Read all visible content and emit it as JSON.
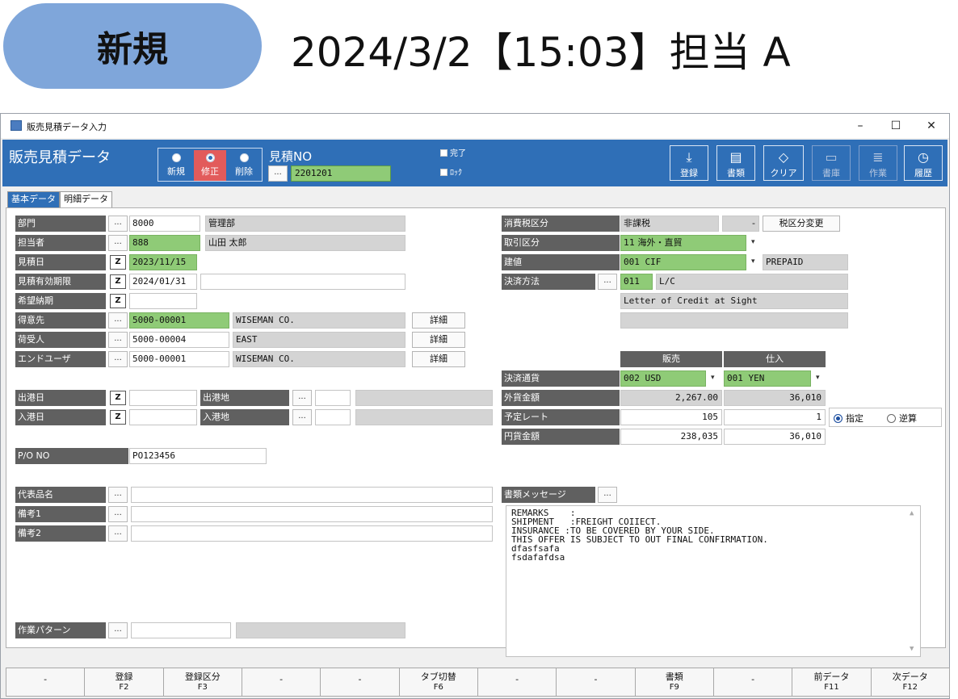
{
  "banner": {
    "mode": "新規",
    "title": "2024/3/2【15:03】担当 A"
  },
  "window": {
    "title": "販売見積データ入力",
    "controls": {
      "minimize": "–",
      "maximize": "☐",
      "close": "✕"
    }
  },
  "header": {
    "title": "販売見積データ",
    "modes": [
      {
        "label": "新規"
      },
      {
        "label": "修正"
      },
      {
        "label": "削除"
      }
    ],
    "mitsumori_label": "見積NO",
    "ellipsis": "...",
    "mitsumori_no": "2201201",
    "checks": {
      "done": "完了",
      "lock": "ﾛｯｸ"
    },
    "tools": [
      {
        "label": "登録",
        "icon": "⤓"
      },
      {
        "label": "書類",
        "icon": "▤"
      },
      {
        "label": "クリア",
        "icon": "◇"
      },
      {
        "label": "書庫",
        "icon": "▭"
      },
      {
        "label": "作業",
        "icon": "≣"
      },
      {
        "label": "履歴",
        "icon": "◷"
      }
    ]
  },
  "tabs": {
    "basic": "基本データ",
    "detail": "明細データ"
  },
  "left": {
    "dept": {
      "label": "部門",
      "code": "8000",
      "name": "管理部"
    },
    "staff": {
      "label": "担当者",
      "code": "888",
      "name": "山田 太郎"
    },
    "quote_date": {
      "label": "見積日",
      "value": "2023/11/15"
    },
    "valid_until": {
      "label": "見積有効期限",
      "value": "2024/01/31"
    },
    "desired_delivery": {
      "label": "希望納期"
    },
    "customer": {
      "label": "得意先",
      "code": "5000-00001",
      "name": "WISEMAN CO.",
      "btn": "詳細"
    },
    "consignee": {
      "label": "荷受人",
      "code": "5000-00004",
      "name": "EAST",
      "btn": "詳細"
    },
    "end_user": {
      "label": "エンドユーザ",
      "code": "5000-00001",
      "name": "WISEMAN CO.",
      "btn": "詳細"
    },
    "ship_date": {
      "label": "出港日"
    },
    "ship_port": {
      "label": "出港地"
    },
    "arrive_date": {
      "label": "入港日"
    },
    "arrive_port": {
      "label": "入港地"
    },
    "po": {
      "label": "P/O NO",
      "value": "PO123456"
    },
    "rep_item": {
      "label": "代表品名"
    },
    "note1": {
      "label": "備考1"
    },
    "note2": {
      "label": "備考2"
    },
    "work_pattern": {
      "label": "作業パターン"
    }
  },
  "right": {
    "tax": {
      "label": "消費税区分",
      "value": "非課税",
      "dash": "-",
      "btn": "税区分変更"
    },
    "trade": {
      "label": "取引区分",
      "value": "11 海外・直貿"
    },
    "price_term": {
      "label": "建値",
      "value": "001 CIF",
      "extra": "PREPAID"
    },
    "payment": {
      "label": "決済方法",
      "code": "011",
      "name": "L/C",
      "desc": "Letter of Credit at Sight"
    },
    "col_sales": "販売",
    "col_purchase": "仕入",
    "currency": {
      "label": "決済通貨",
      "sales": "002 USD",
      "purchase": "001 YEN"
    },
    "foreign_amount": {
      "label": "外貨金額",
      "sales": "2,267.00",
      "purchase": "36,010"
    },
    "rate": {
      "label": "予定レート",
      "sales": "105",
      "purchase": "1"
    },
    "yen_amount": {
      "label": "円貨金額",
      "sales": "238,035",
      "purchase": "36,010"
    },
    "rate_mode": {
      "specify": "指定",
      "reverse": "逆算"
    },
    "doc_message": {
      "label": "書類メッセージ"
    },
    "memo_lines": [
      "REMARKS    :",
      "SHIPMENT   :FREIGHT COIIECT.",
      "INSURANCE :TO BE COVERED BY YOUR SIDE.",
      "THIS OFFER IS SUBJECT TO OUT FINAL CONFIRMATION.",
      "dfasfsafa",
      "fsdafafdsa"
    ]
  },
  "fkeys": [
    {
      "label": "-",
      "key": ""
    },
    {
      "label": "登録",
      "key": "F2"
    },
    {
      "label": "登録区分",
      "key": "F3"
    },
    {
      "label": "-",
      "key": ""
    },
    {
      "label": "-",
      "key": ""
    },
    {
      "label": "タブ切替",
      "key": "F6"
    },
    {
      "label": "-",
      "key": ""
    },
    {
      "label": "-",
      "key": ""
    },
    {
      "label": "書類",
      "key": "F9"
    },
    {
      "label": "-",
      "key": ""
    },
    {
      "label": "前データ",
      "key": "F11"
    },
    {
      "label": "次データ",
      "key": "F12"
    }
  ],
  "colors": {
    "header_blue": "#2f6fb7",
    "field_green": "#8fcb77",
    "label_gray": "#606060",
    "active_mode": "#e25b5b",
    "pill": "#7fa6da"
  }
}
